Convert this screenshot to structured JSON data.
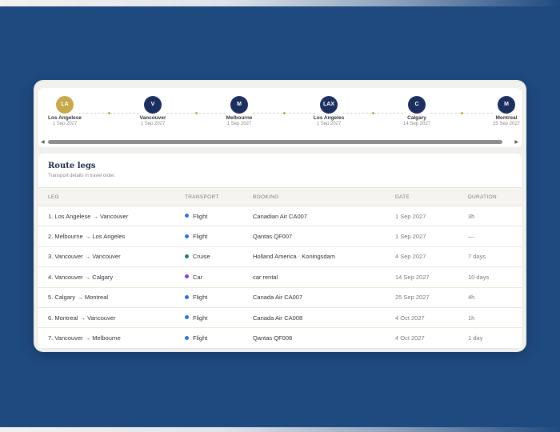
{
  "timeline": {
    "stops": [
      {
        "code": "LA",
        "city": "Los Angelese",
        "date": "1 Sep 2027",
        "home": true
      },
      {
        "code": "V",
        "city": "Vancouver",
        "date": "1 Sep 2027",
        "home": false
      },
      {
        "code": "M",
        "city": "Melbourne",
        "date": "1 Sep 2027",
        "home": false
      },
      {
        "code": "LAX",
        "city": "Los Angeles",
        "date": "1 Sep 2027",
        "home": false
      },
      {
        "code": "C",
        "city": "Calgary",
        "date": "14 Sep 2027",
        "home": false
      },
      {
        "code": "M",
        "city": "Montreal",
        "date": "25 Sep 2027",
        "home": false
      }
    ],
    "scroll_left_icon": "◀",
    "scroll_right_icon": "▶"
  },
  "route_legs": {
    "title": "Route legs",
    "subtitle": "Transport details in travel order.",
    "columns": [
      "LEG",
      "TRANSPORT",
      "BOOKING",
      "DATE",
      "DURATION"
    ],
    "rows": [
      {
        "leg": "1. Los Angelese → Vancouver",
        "transport": "Flight",
        "color": "#2f6fdc",
        "booking": "Canadian Air CA007",
        "date": "1 Sep 2027",
        "duration": "3h"
      },
      {
        "leg": "2. Melbourne → Los Angeles",
        "transport": "Flight",
        "color": "#2f6fdc",
        "booking": "Qantas QF007",
        "date": "1 Sep 2027",
        "duration": "—"
      },
      {
        "leg": "3. Vancouver → Vancouver",
        "transport": "Cruise",
        "color": "#1d7a7a",
        "booking": "Holland America · Koningsdam",
        "date": "4 Sep 2027",
        "duration": "7 days"
      },
      {
        "leg": "4. Vancouver → Calgary",
        "transport": "Car",
        "color": "#7a3fd6",
        "booking": "car rental",
        "date": "14 Sep 2027",
        "duration": "10 days"
      },
      {
        "leg": "5. Calgary → Montreal",
        "transport": "Flight",
        "color": "#2f6fdc",
        "booking": "Canada Air CA007",
        "date": "25 Sep 2027",
        "duration": "4h"
      },
      {
        "leg": "6. Montreal → Vancouver",
        "transport": "Flight",
        "color": "#2f6fdc",
        "booking": "Canada Air CA008",
        "date": "4 Oct 2027",
        "duration": "1h"
      },
      {
        "leg": "7. Vancouver → Melbourne",
        "transport": "Flight",
        "color": "#2f6fdc",
        "booking": "Qantas QF008",
        "date": "4 Oct 2027",
        "duration": "1 day"
      }
    ]
  },
  "colors": {
    "background": "#1f4a80",
    "home_stop": "#c8a84d",
    "stop": "#1c2f5e"
  }
}
